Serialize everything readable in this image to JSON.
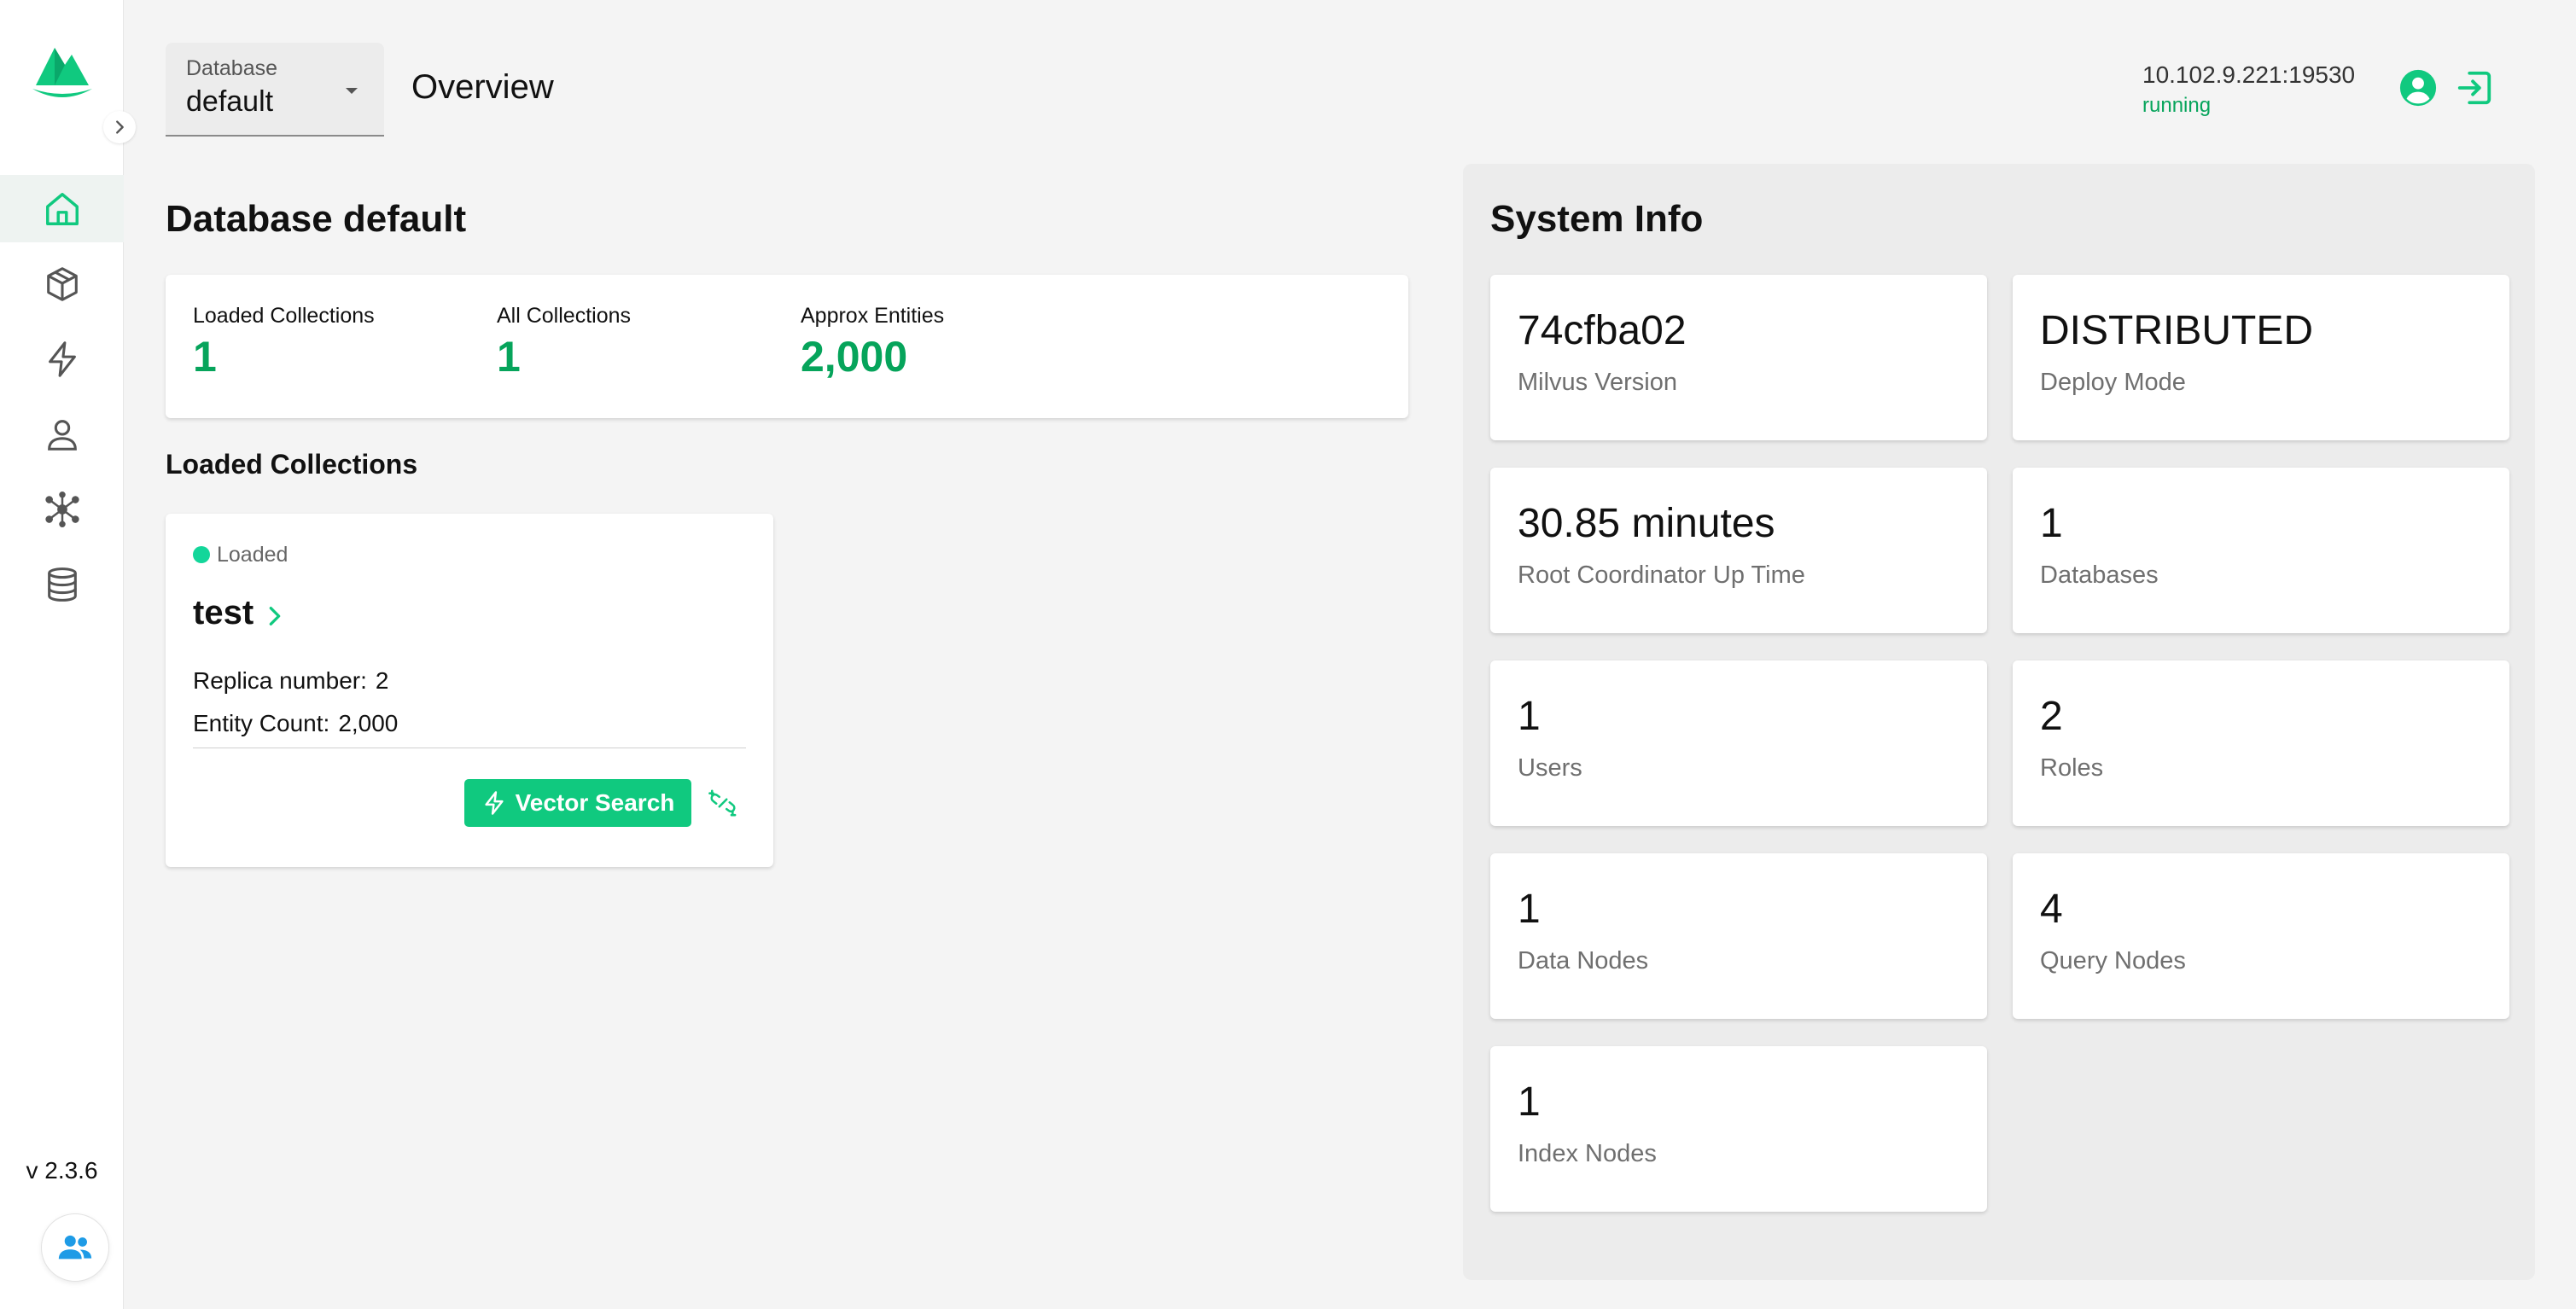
{
  "sidebar": {
    "version": "v 2.3.6",
    "nav_items": [
      {
        "name": "home",
        "icon": "home-icon",
        "active": true
      },
      {
        "name": "collections",
        "icon": "cube-icon",
        "active": false
      },
      {
        "name": "search",
        "icon": "lightning-icon",
        "active": false
      },
      {
        "name": "users",
        "icon": "person-icon",
        "active": false
      },
      {
        "name": "system",
        "icon": "network-icon",
        "active": false
      },
      {
        "name": "databases",
        "icon": "database-icon",
        "active": false
      }
    ]
  },
  "header": {
    "database_label": "Database",
    "database_value": "default",
    "title": "Overview",
    "server_address": "10.102.9.221:19530",
    "server_status": "running"
  },
  "database": {
    "heading": "Database default",
    "stats": [
      {
        "label": "Loaded Collections",
        "value": "1"
      },
      {
        "label": "All Collections",
        "value": "1"
      },
      {
        "label": "Approx Entities",
        "value": "2,000"
      }
    ],
    "loaded_heading": "Loaded Collections",
    "collection": {
      "status": "Loaded",
      "name": "test",
      "replica_label": "Replica number:",
      "replica_value": "2",
      "entity_label": "Entity Count:",
      "entity_value": "2,000",
      "action_label": "Vector Search"
    }
  },
  "system_info": {
    "heading": "System Info",
    "cards": [
      {
        "value": "74cfba02",
        "label": "Milvus Version"
      },
      {
        "value": "DISTRIBUTED",
        "label": "Deploy Mode"
      },
      {
        "value": "30.85 minutes",
        "label": "Root Coordinator Up Time"
      },
      {
        "value": "1",
        "label": "Databases"
      },
      {
        "value": "1",
        "label": "Users"
      },
      {
        "value": "2",
        "label": "Roles"
      },
      {
        "value": "1",
        "label": "Data Nodes"
      },
      {
        "value": "4",
        "label": "Query Nodes"
      },
      {
        "value": "1",
        "label": "Index Nodes"
      }
    ]
  },
  "colors": {
    "accent": "#10c97f",
    "accent_text": "#06a45b",
    "status_dot": "#13d69a",
    "team_icon": "#1e9be6"
  }
}
